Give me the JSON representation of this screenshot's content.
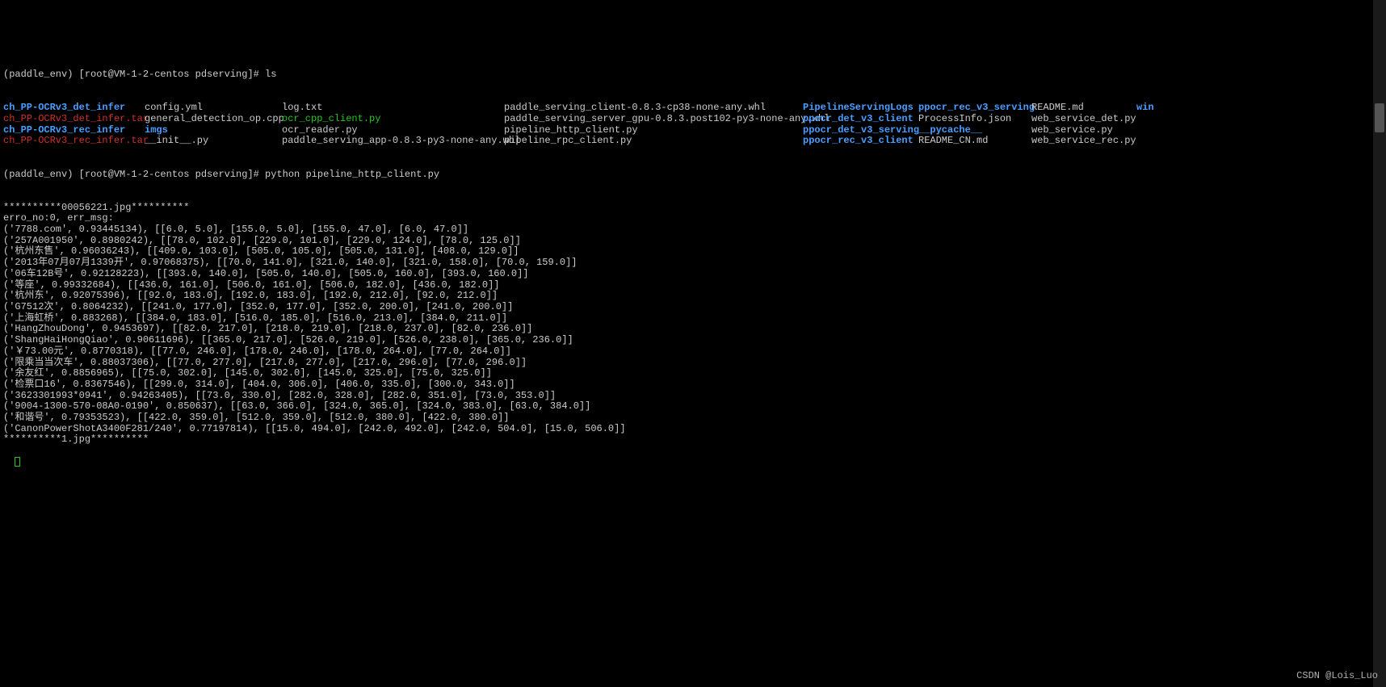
{
  "prompt1": "(paddle_env) [root@VM-1-2-centos pdserving]# ls",
  "ls": {
    "rows": [
      [
        {
          "text": "ch_PP-OCRv3_det_infer",
          "cls": "fs-dir"
        },
        {
          "text": "config.yml",
          "cls": "fs-file"
        },
        {
          "text": "log.txt",
          "cls": "fs-file"
        },
        {
          "text": "paddle_serving_client-0.8.3-cp38-none-any.whl",
          "cls": "fs-file"
        },
        {
          "text": "PipelineServingLogs",
          "cls": "fs-cyan"
        },
        {
          "text": "ppocr_rec_v3_serving",
          "cls": "fs-cyan"
        },
        {
          "text": "README.md",
          "cls": "fs-file"
        },
        {
          "text": "win",
          "cls": "fs-cyan"
        }
      ],
      [
        {
          "text": "ch_PP-OCRv3_det_infer.tar",
          "cls": "fs-tar"
        },
        {
          "text": "general_detection_op.cpp",
          "cls": "fs-file"
        },
        {
          "text": "ocr_cpp_client.py",
          "cls": "fs-green"
        },
        {
          "text": "paddle_serving_server_gpu-0.8.3.post102-py3-none-any.whl",
          "cls": "fs-file"
        },
        {
          "text": "ppocr_det_v3_client",
          "cls": "fs-cyan"
        },
        {
          "text": "ProcessInfo.json",
          "cls": "fs-file"
        },
        {
          "text": "web_service_det.py",
          "cls": "fs-file"
        },
        {
          "text": "",
          "cls": "fs-file"
        }
      ],
      [
        {
          "text": "ch_PP-OCRv3_rec_infer",
          "cls": "fs-dir"
        },
        {
          "text": "imgs",
          "cls": "fs-cyan"
        },
        {
          "text": "ocr_reader.py",
          "cls": "fs-file"
        },
        {
          "text": "pipeline_http_client.py",
          "cls": "fs-file"
        },
        {
          "text": "ppocr_det_v3_serving",
          "cls": "fs-cyan"
        },
        {
          "text": "__pycache__",
          "cls": "fs-cyan"
        },
        {
          "text": "web_service.py",
          "cls": "fs-file"
        },
        {
          "text": "",
          "cls": "fs-file"
        }
      ],
      [
        {
          "text": "ch_PP-OCRv3_rec_infer.tar",
          "cls": "fs-tar"
        },
        {
          "text": "__init__.py",
          "cls": "fs-file"
        },
        {
          "text": "paddle_serving_app-0.8.3-py3-none-any.whl",
          "cls": "fs-file"
        },
        {
          "text": "pipeline_rpc_client.py",
          "cls": "fs-file"
        },
        {
          "text": "ppocr_rec_v3_client",
          "cls": "fs-cyan"
        },
        {
          "text": "README_CN.md",
          "cls": "fs-file"
        },
        {
          "text": "web_service_rec.py",
          "cls": "fs-file"
        },
        {
          "text": "",
          "cls": "fs-file"
        }
      ]
    ]
  },
  "prompt2": "(paddle_env) [root@VM-1-2-centos pdserving]# python pipeline_http_client.py",
  "output": [
    "**********00056221.jpg**********",
    "erro_no:0, err_msg:",
    "('7788.com', 0.93445134), [[6.0, 5.0], [155.0, 5.0], [155.0, 47.0], [6.0, 47.0]]",
    "('257A001950', 0.8980242), [[78.0, 102.0], [229.0, 101.0], [229.0, 124.0], [78.0, 125.0]]",
    "('杭州东售', 0.96036243), [[409.0, 103.0], [505.0, 105.0], [505.0, 131.0], [408.0, 129.0]]",
    "('2013年07月07月1339开', 0.97068375), [[70.0, 141.0], [321.0, 140.0], [321.0, 158.0], [70.0, 159.0]]",
    "('06车12B号', 0.92128223), [[393.0, 140.0], [505.0, 140.0], [505.0, 160.0], [393.0, 160.0]]",
    "('等座', 0.99332684), [[436.0, 161.0], [506.0, 161.0], [506.0, 182.0], [436.0, 182.0]]",
    "('杭州东', 0.92075396), [[92.0, 183.0], [192.0, 183.0], [192.0, 212.0], [92.0, 212.0]]",
    "('G7512次', 0.8064232), [[241.0, 177.0], [352.0, 177.0], [352.0, 200.0], [241.0, 200.0]]",
    "('上海虹桥', 0.883268), [[384.0, 183.0], [516.0, 185.0], [516.0, 213.0], [384.0, 211.0]]",
    "('HangZhouDong', 0.9453697), [[82.0, 217.0], [218.0, 219.0], [218.0, 237.0], [82.0, 236.0]]",
    "('ShangHaiHongQiao', 0.90611696), [[365.0, 217.0], [526.0, 219.0], [526.0, 238.0], [365.0, 236.0]]",
    "('￥73.00元', 0.8770318), [[77.0, 246.0], [178.0, 246.0], [178.0, 264.0], [77.0, 264.0]]",
    "('限乘当当次车', 0.88037306), [[77.0, 277.0], [217.0, 277.0], [217.0, 296.0], [77.0, 296.0]]",
    "('余友红', 0.8856965), [[75.0, 302.0], [145.0, 302.0], [145.0, 325.0], [75.0, 325.0]]",
    "('检票口16', 0.8367546), [[299.0, 314.0], [404.0, 306.0], [406.0, 335.0], [300.0, 343.0]]",
    "('3623301993*0941', 0.94263405), [[73.0, 330.0], [282.0, 328.0], [282.0, 351.0], [73.0, 353.0]]",
    "('9004-1300-570-08A0-0190', 0.850637), [[63.0, 366.0], [324.0, 365.0], [324.0, 383.0], [63.0, 384.0]]",
    "('和谐号', 0.79353523), [[422.0, 359.0], [512.0, 359.0], [512.0, 380.0], [422.0, 380.0]]",
    "('CanonPowerShotA3400F281/240', 0.77197814), [[15.0, 494.0], [242.0, 492.0], [242.0, 504.0], [15.0, 506.0]]",
    "**********1.jpg**********"
  ],
  "watermark": "CSDN @Lois_Luo"
}
